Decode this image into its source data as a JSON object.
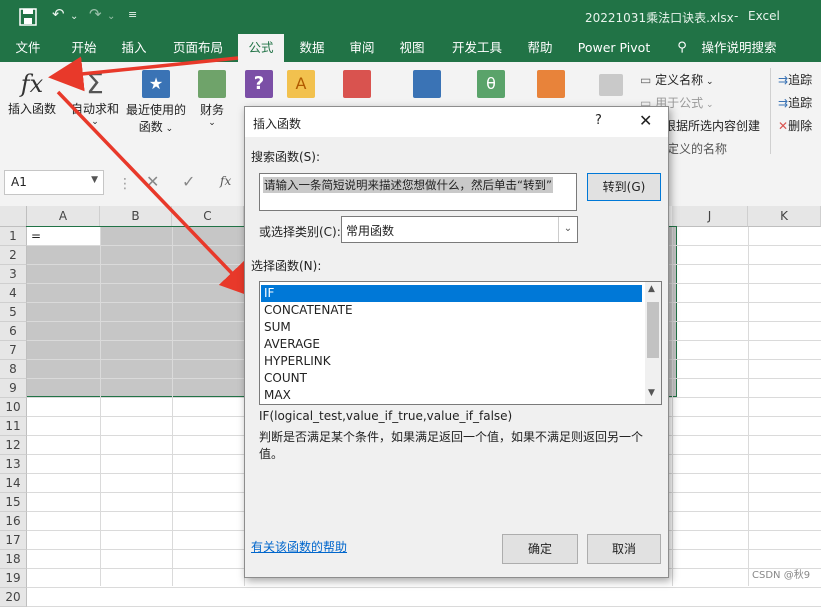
{
  "titlebar": {
    "filename": "20221031乘法口诀表.xlsx",
    "sep": "-",
    "app": "Excel"
  },
  "tabs": [
    "文件",
    "开始",
    "插入",
    "页面布局",
    "公式",
    "数据",
    "审阅",
    "视图",
    "开发工具",
    "帮助",
    "Power Pivot",
    "操作说明搜索"
  ],
  "ribbon": {
    "insert_function": "插入函数",
    "autosum": "自动求和",
    "recent_1": "最近使用的",
    "recent_2": "函数",
    "financial": "财务",
    "define_name": "定义名称",
    "use_in_formula": "用于公式",
    "create_from_sel": "根据所选内容创建",
    "defined_names": "定义的名称",
    "trace_1": "追踪",
    "trace_2": "追踪",
    "remove": "删除"
  },
  "formula_bar": {
    "namebox": "A1",
    "fx": "fx"
  },
  "grid": {
    "columns": [
      "A",
      "B",
      "C",
      "J",
      "K"
    ],
    "rows": [
      "1",
      "2",
      "3",
      "4",
      "5",
      "6",
      "7",
      "8",
      "9",
      "10",
      "11",
      "12",
      "13",
      "14",
      "15",
      "16",
      "17",
      "18",
      "19",
      "20"
    ],
    "a1_value": "="
  },
  "dialog": {
    "title": "插入函数",
    "help_btn": "?",
    "search_label": "搜索函数(S):",
    "search_placeholder": "请输入一条简短说明来描述您想做什么，然后单击“转到”",
    "goto_btn": "转到(G)",
    "category_label": "或选择类别(C):",
    "category_value": "常用函数",
    "select_label": "选择函数(N):",
    "functions": [
      "IF",
      "CONCATENATE",
      "SUM",
      "AVERAGE",
      "HYPERLINK",
      "COUNT",
      "MAX"
    ],
    "signature": "IF(logical_test,value_if_true,value_if_false)",
    "description": "判断是否满足某个条件，如果满足返回一个值，如果不满足则返回另一个值。",
    "help_link": "有关该函数的帮助",
    "ok": "确定",
    "cancel": "取消"
  },
  "watermark": "CSDN @秋9",
  "colors": {
    "excel_green": "#217346",
    "arrow_red": "#e8392a",
    "selection_blue": "#0078d7"
  }
}
